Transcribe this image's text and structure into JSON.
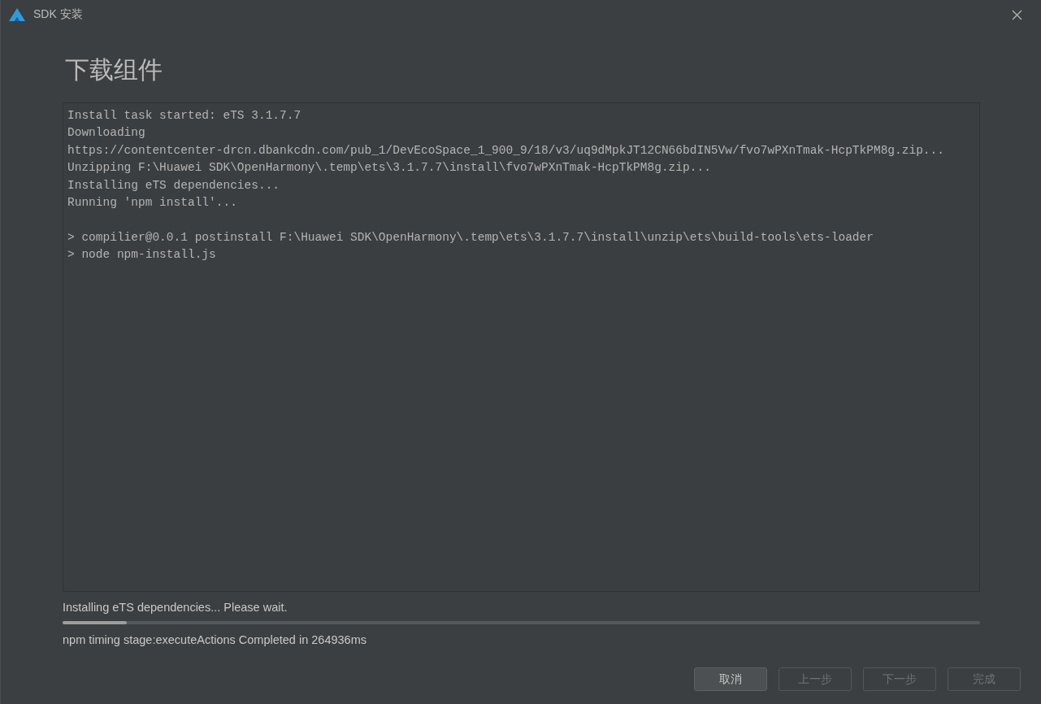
{
  "window": {
    "title": "SDK 安装"
  },
  "heading": "下载组件",
  "log_blocks": [
    [
      "Install task started: eTS 3.1.7.7",
      "Downloading",
      "https://contentcenter-drcn.dbankcdn.com/pub_1/DevEcoSpace_1_900_9/18/v3/uq9dMpkJT12CN66bdIN5Vw/fvo7wPXnTmak-HcpTkPM8g.zip...",
      "Unzipping F:\\Huawei SDK\\OpenHarmony\\.temp\\ets\\3.1.7.7\\install\\fvo7wPXnTmak-HcpTkPM8g.zip...",
      "Installing eTS dependencies...",
      "Running 'npm install'..."
    ],
    [
      "> compilier@0.0.1 postinstall F:\\Huawei SDK\\OpenHarmony\\.temp\\ets\\3.1.7.7\\install\\unzip\\ets\\build-tools\\ets-loader",
      "> node npm-install.js"
    ]
  ],
  "status": "Installing eTS dependencies... Please wait.",
  "progress": {
    "level": 0.07
  },
  "detail": "npm timing stage:executeActions Completed in 264936ms",
  "buttons": [
    {
      "label": "取消",
      "disabled": false
    },
    {
      "label": "上一步",
      "disabled": true
    },
    {
      "label": "下一步",
      "disabled": true
    },
    {
      "label": "完成",
      "disabled": true
    }
  ]
}
